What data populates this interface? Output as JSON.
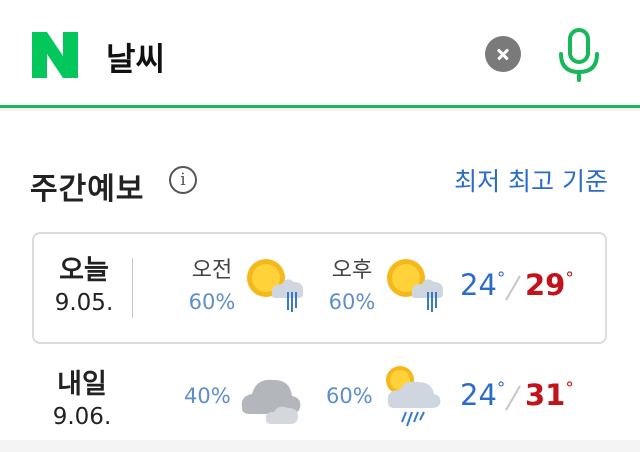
{
  "search": {
    "query": "날씨"
  },
  "forecast": {
    "title": "주간예보",
    "info_symbol": "i",
    "toggle_label": "최저 최고 기준",
    "days": [
      {
        "name": "오늘",
        "date": "9.05.",
        "am_label": "오전",
        "am_precip": "60%",
        "am_icon": "sun-cloud-rain-icon",
        "pm_label": "오후",
        "pm_precip": "60%",
        "pm_icon": "sun-cloud-rain-icon",
        "low": "24",
        "high": "29"
      },
      {
        "name": "내일",
        "date": "9.06.",
        "am_precip": "40%",
        "am_icon": "cloudy-icon",
        "pm_precip": "60%",
        "pm_icon": "sun-cloud-shower-icon",
        "low": "24",
        "high": "31"
      }
    ]
  },
  "colors": {
    "brand_green": "#03c75a",
    "accent_blue": "#2a6cc8",
    "high_red": "#c4121b",
    "precip_blue": "#5f8fc9"
  }
}
